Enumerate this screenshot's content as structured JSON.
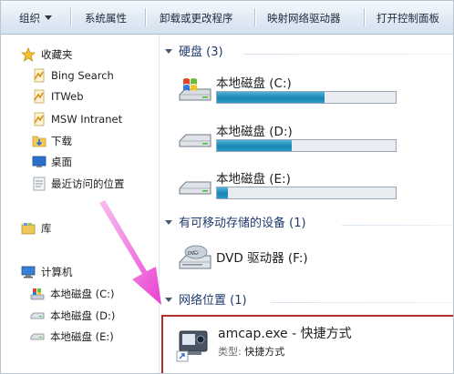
{
  "toolbar": {
    "organize": "组织",
    "system_properties": "系统属性",
    "uninstall": "卸载或更改程序",
    "map_drive": "映射网络驱动器",
    "control_panel": "打开控制面板"
  },
  "nav": {
    "favorites": "收藏夹",
    "bing": "Bing Search",
    "itweb": "ITWeb",
    "msw": "MSW Intranet",
    "downloads": "下载",
    "desktop": "桌面",
    "recent": "最近访问的位置",
    "libraries": "库",
    "computer": "计算机",
    "drive_c": "本地磁盘 (C:)",
    "drive_d": "本地磁盘 (D:)",
    "drive_e": "本地磁盘 (E:)"
  },
  "main": {
    "hdd_header": "硬盘 (3)",
    "drives": [
      {
        "name": "本地磁盘 (C:)",
        "used_fraction": 0.6
      },
      {
        "name": "本地磁盘 (D:)",
        "used_fraction": 0.42
      },
      {
        "name": "本地磁盘 (E:)",
        "used_fraction": 0.06
      }
    ],
    "removable_header": "有可移动存储的设备 (1)",
    "dvd_name": "DVD 驱动器 (F:)",
    "network_header": "网络位置 (1)",
    "shortcut_name": "amcap.exe - 快捷方式",
    "shortcut_type_label": "类型:",
    "shortcut_type_value": "快捷方式"
  },
  "colors": {
    "accent_arrow": "#e83ed0",
    "highlight_border": "#b03030",
    "bar_fill": "#1a84b5"
  }
}
